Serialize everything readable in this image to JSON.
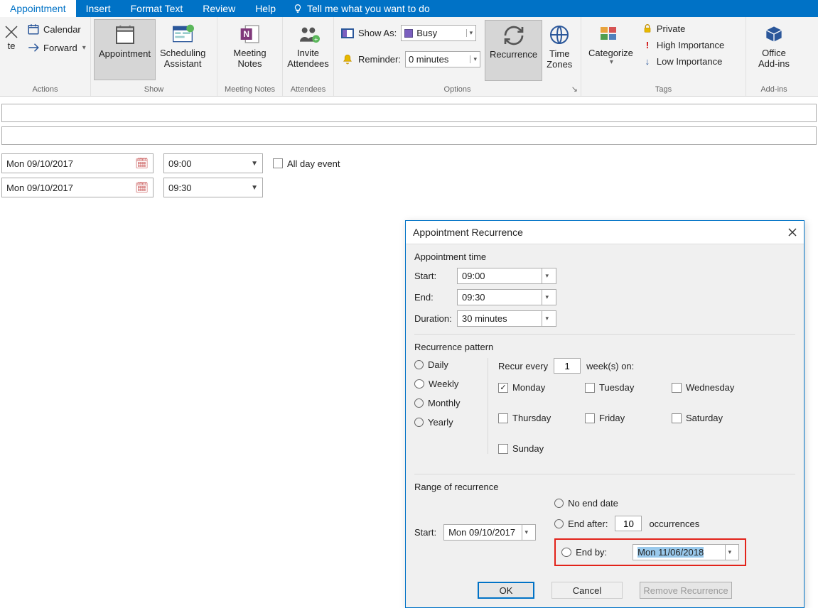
{
  "tabs": {
    "appointment": "Appointment",
    "insert": "Insert",
    "format_text": "Format Text",
    "review": "Review",
    "help": "Help",
    "tell_me": "Tell me what you want to do"
  },
  "ribbon": {
    "actions": {
      "label": "Actions",
      "delete": "te",
      "calendar": "Calendar",
      "forward": "Forward"
    },
    "show": {
      "label": "Show",
      "appointment": "Appointment",
      "scheduling": "Scheduling\nAssistant"
    },
    "meeting_notes": {
      "label": "Meeting Notes",
      "btn": "Meeting\nNotes"
    },
    "attendees": {
      "label": "Attendees",
      "btn": "Invite\nAttendees"
    },
    "options": {
      "label": "Options",
      "show_as": "Show As:",
      "show_as_value": "Busy",
      "reminder": "Reminder:",
      "reminder_value": "0 minutes",
      "recurrence": "Recurrence",
      "time_zones": "Time\nZones"
    },
    "tags": {
      "label": "Tags",
      "categorize": "Categorize",
      "private": "Private",
      "high": "High Importance",
      "low": "Low Importance"
    },
    "addins": {
      "label": "Add-ins",
      "btn": "Office\nAdd-ins"
    }
  },
  "appointment": {
    "start_date": "Mon 09/10/2017",
    "start_time": "09:00",
    "end_date": "Mon 09/10/2017",
    "end_time": "09:30",
    "all_day": "All day event"
  },
  "dialog": {
    "title": "Appointment Recurrence",
    "sections": {
      "time": "Appointment time",
      "pattern": "Recurrence pattern",
      "range": "Range of recurrence"
    },
    "time": {
      "start_label": "Start:",
      "start_value": "09:00",
      "end_label": "End:",
      "end_value": "09:30",
      "duration_label": "Duration:",
      "duration_value": "30 minutes"
    },
    "pattern": {
      "daily": "Daily",
      "weekly": "Weekly",
      "monthly": "Monthly",
      "yearly": "Yearly",
      "recur_every": "Recur every",
      "recur_count": "1",
      "weeks_on": "week(s) on:",
      "days": {
        "mon": "Monday",
        "tue": "Tuesday",
        "wed": "Wednesday",
        "thu": "Thursday",
        "fri": "Friday",
        "sat": "Saturday",
        "sun": "Sunday"
      }
    },
    "range": {
      "start_label": "Start:",
      "start_value": "Mon 09/10/2017",
      "no_end": "No end date",
      "end_after": "End after:",
      "end_after_value": "10",
      "occurrences": "occurrences",
      "end_by": "End by:",
      "end_by_value": "Mon 11/06/2018"
    },
    "buttons": {
      "ok": "OK",
      "cancel": "Cancel",
      "remove": "Remove Recurrence"
    }
  }
}
